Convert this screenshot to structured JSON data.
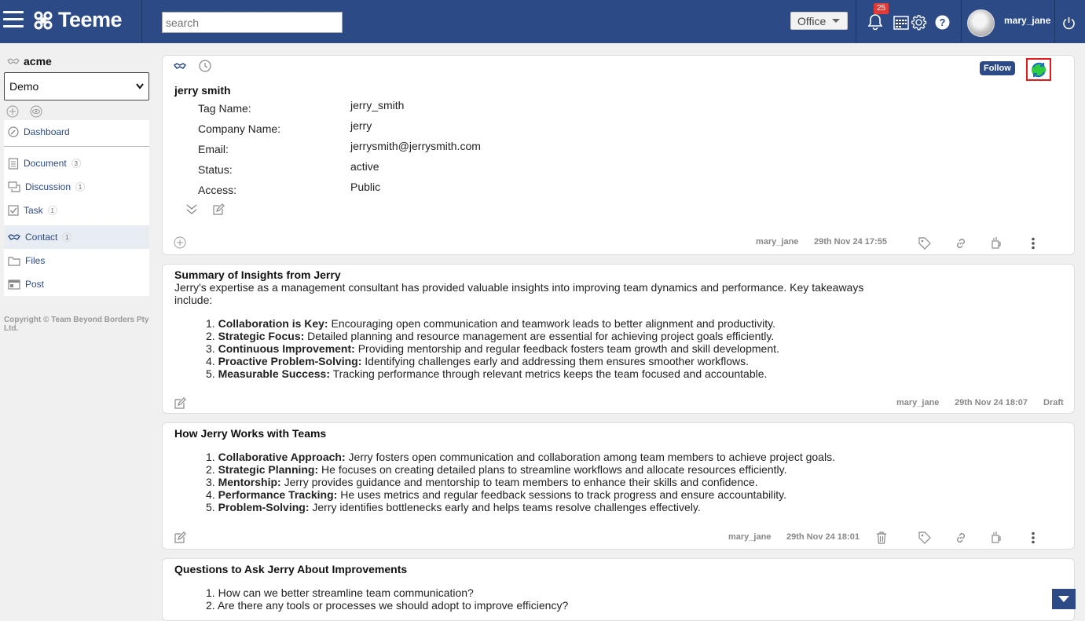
{
  "header": {
    "app_name": "Teeme",
    "search_placeholder": "search",
    "workspace_select": "Office",
    "notification_count": "25",
    "username": "mary_jane"
  },
  "sidebar": {
    "org_name": "acme",
    "org_select": "Demo",
    "items": [
      {
        "label": "Dashboard",
        "count": ""
      },
      {
        "label": "Document",
        "count": "3"
      },
      {
        "label": "Discussion",
        "count": "1"
      },
      {
        "label": "Task",
        "count": "1"
      },
      {
        "label": "Contact",
        "count": "1"
      },
      {
        "label": "Files",
        "count": ""
      },
      {
        "label": "Post",
        "count": ""
      }
    ],
    "copyright": "Copyright © Team Beyond Borders Pty Ltd."
  },
  "contact": {
    "name": "jerry smith",
    "follow_label": "Follow",
    "fields": [
      {
        "label": "Tag Name:",
        "value": "jerry_smith"
      },
      {
        "label": "Company Name:",
        "value": "jerry"
      },
      {
        "label": "Email:",
        "value": "jerrysmith@jerrysmith.com"
      },
      {
        "label": "Status:",
        "value": "active"
      },
      {
        "label": "Access:",
        "value": "Public"
      }
    ],
    "author": "mary_jane",
    "timestamp": "29th Nov 24 17:55"
  },
  "posts": [
    {
      "title": "Summary of Insights from Jerry",
      "intro": "Jerry's expertise as a management consultant has provided valuable insights into improving team dynamics and performance. Key takeaways include:",
      "items": [
        {
          "num": "1.",
          "bold": "Collaboration is Key:",
          "text": " Encouraging open communication and teamwork leads to better alignment and productivity."
        },
        {
          "num": "2.",
          "bold": "Strategic Focus:",
          "text": " Detailed planning and resource management are essential for achieving project goals efficiently."
        },
        {
          "num": "3.",
          "bold": "Continuous Improvement:",
          "text": " Providing mentorship and regular feedback fosters team growth and skill development."
        },
        {
          "num": "4.",
          "bold": "Proactive Problem-Solving:",
          "text": " Identifying challenges early and addressing them ensures smoother workflows."
        },
        {
          "num": "5.",
          "bold": "Measurable Success:",
          "text": " Tracking performance through relevant metrics keeps the team focused and accountable."
        }
      ],
      "author": "mary_jane",
      "timestamp": "29th Nov 24 18:07",
      "status": "Draft"
    },
    {
      "title": "How Jerry Works with Teams",
      "items": [
        {
          "num": "1.",
          "bold": "Collaborative Approach:",
          "text": " Jerry fosters open communication and collaboration among team members to achieve project goals."
        },
        {
          "num": "2.",
          "bold": "Strategic Planning:",
          "text": " He focuses on creating detailed plans to streamline workflows and allocate resources efficiently."
        },
        {
          "num": "3.",
          "bold": "Mentorship:",
          "text": " Jerry provides guidance and mentorship to team members to enhance their skills and confidence."
        },
        {
          "num": "4.",
          "bold": "Performance Tracking:",
          "text": " He uses metrics and regular feedback sessions to track progress and ensure accountability."
        },
        {
          "num": "5.",
          "bold": "Problem-Solving:",
          "text": " Jerry identifies bottlenecks early and helps teams resolve challenges effectively."
        }
      ],
      "author": "mary_jane",
      "timestamp": "29th Nov 24 18:01"
    },
    {
      "title": "Questions to Ask Jerry About Improvements",
      "items": [
        {
          "num": "1.",
          "text": "How can we better streamline team communication?"
        },
        {
          "num": "2.",
          "text": "Are there any tools or processes we should adopt to improve efficiency?"
        }
      ]
    }
  ],
  "colors": {
    "brand": "#2c4a85",
    "link": "#2b4a86",
    "badge": "#e53935",
    "highlight": "#e21c1c"
  }
}
